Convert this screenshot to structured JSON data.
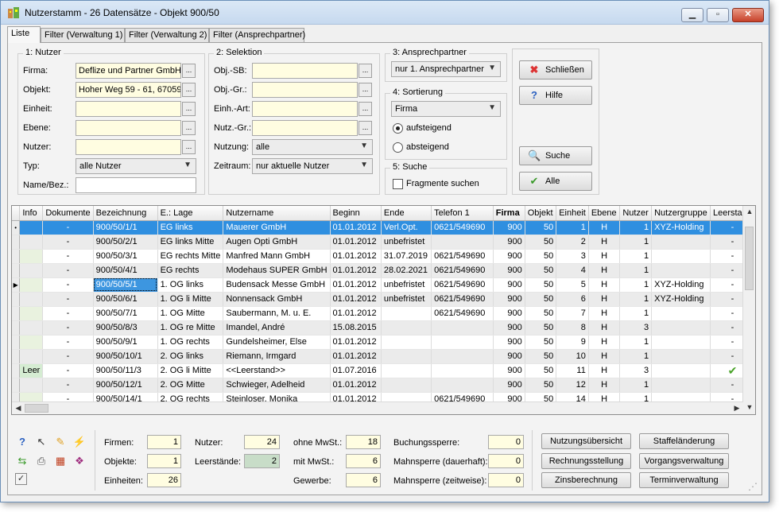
{
  "window": {
    "title": "Nutzerstamm - 26 Datensätze - Objekt 900/50",
    "buttons": {
      "minimize": "▁",
      "maximize": "▫",
      "close": "✕"
    }
  },
  "tabs": [
    "Liste",
    "Filter (Verwaltung 1)",
    "Filter (Verwaltung 2)",
    "Filter (Ansprechpartner)"
  ],
  "group_nutzer": {
    "title": "1: Nutzer",
    "firma_label": "Firma:",
    "firma_value": "Deflize und Partner GmbH",
    "objekt_label": "Objekt:",
    "objekt_value": "Hoher Weg 59 - 61, 67059",
    "einheit_label": "Einheit:",
    "ebene_label": "Ebene:",
    "nutzer_label": "Nutzer:",
    "typ_label": "Typ:",
    "typ_value": "alle Nutzer",
    "namebez_label": "Name/Bez.:",
    "dots": "..."
  },
  "group_selektion": {
    "title": "2: Selektion",
    "objsb_label": "Obj.-SB:",
    "objgr_label": "Obj.-Gr.:",
    "einhart_label": "Einh.-Art:",
    "nutzgr_label": "Nutz.-Gr.:",
    "nutzung_label": "Nutzung:",
    "nutzung_value": "alle",
    "zeitraum_label": "Zeitraum:",
    "zeitraum_value": "nur aktuelle Nutzer"
  },
  "group_ansprech": {
    "title": "3: Ansprechpartner",
    "value": "nur 1. Ansprechpartner"
  },
  "group_sort": {
    "title": "4: Sortierung",
    "value": "Firma",
    "asc": "aufsteigend",
    "desc": "absteigend"
  },
  "group_suche": {
    "title": "5: Suche",
    "fragment": "Fragmente suchen"
  },
  "actions": {
    "close": "Schließen",
    "help": "Hilfe",
    "search": "Suche",
    "all": "Alle"
  },
  "grid": {
    "columns": [
      "Info",
      "Dokumente",
      "Bezeichnung",
      "E.: Lage",
      "Nutzername",
      "Beginn",
      "Ende",
      "Telefon 1",
      "Firma",
      "Objekt",
      "Einheit",
      "Ebene",
      "Nutzer",
      "Nutzergruppe",
      "Leerstand"
    ],
    "rows": [
      {
        "ind": "•",
        "info": "",
        "doc": "-",
        "bez": "900/50/1/1",
        "lage": "EG links",
        "name": "Mauerer GmbH",
        "beginn": "01.01.2012",
        "ende": "Verl.Opt.",
        "tel": "0621/549690",
        "firma": "900",
        "objekt": "50",
        "einheit": "1",
        "ebene": "H",
        "nutzer": "1",
        "gruppe": "XYZ-Holding",
        "leer": "-"
      },
      {
        "ind": "",
        "info": "",
        "doc": "-",
        "bez": "900/50/2/1",
        "lage": "EG links Mitte",
        "name": "Augen Opti GmbH",
        "beginn": "01.01.2012",
        "ende": "unbefristet",
        "tel": "",
        "firma": "900",
        "objekt": "50",
        "einheit": "2",
        "ebene": "H",
        "nutzer": "1",
        "gruppe": "",
        "leer": "-"
      },
      {
        "ind": "",
        "info": "",
        "doc": "-",
        "bez": "900/50/3/1",
        "lage": "EG rechts Mitte",
        "name": "Manfred Mann GmbH",
        "beginn": "01.01.2012",
        "ende": "31.07.2019",
        "tel": "0621/549690",
        "firma": "900",
        "objekt": "50",
        "einheit": "3",
        "ebene": "H",
        "nutzer": "1",
        "gruppe": "",
        "leer": "-"
      },
      {
        "ind": "",
        "info": "",
        "doc": "-",
        "bez": "900/50/4/1",
        "lage": "EG rechts",
        "name": "Modehaus SUPER GmbH",
        "beginn": "01.01.2012",
        "ende": "28.02.2021",
        "tel": "0621/549690",
        "firma": "900",
        "objekt": "50",
        "einheit": "4",
        "ebene": "H",
        "nutzer": "1",
        "gruppe": "",
        "leer": "-"
      },
      {
        "ind": "▶",
        "info": "",
        "doc": "-",
        "bez": "900/50/5/1",
        "lage": "1. OG links",
        "name": "Budensack Messe GmbH",
        "beginn": "01.01.2012",
        "ende": "unbefristet",
        "tel": "0621/549690",
        "firma": "900",
        "objekt": "50",
        "einheit": "5",
        "ebene": "H",
        "nutzer": "1",
        "gruppe": "XYZ-Holding",
        "leer": "-"
      },
      {
        "ind": "",
        "info": "",
        "doc": "-",
        "bez": "900/50/6/1",
        "lage": "1. OG li Mitte",
        "name": "Nonnensack GmbH",
        "beginn": "01.01.2012",
        "ende": "unbefristet",
        "tel": "0621/549690",
        "firma": "900",
        "objekt": "50",
        "einheit": "6",
        "ebene": "H",
        "nutzer": "1",
        "gruppe": "XYZ-Holding",
        "leer": "-"
      },
      {
        "ind": "",
        "info": "",
        "doc": "-",
        "bez": "900/50/7/1",
        "lage": "1. OG Mitte",
        "name": "Saubermann, M. u. E.",
        "beginn": "01.01.2012",
        "ende": "",
        "tel": "0621/549690",
        "firma": "900",
        "objekt": "50",
        "einheit": "7",
        "ebene": "H",
        "nutzer": "1",
        "gruppe": "",
        "leer": "-"
      },
      {
        "ind": "",
        "info": "",
        "doc": "-",
        "bez": "900/50/8/3",
        "lage": "1. OG re Mitte",
        "name": "Imandel, André",
        "beginn": "15.08.2015",
        "ende": "",
        "tel": "",
        "firma": "900",
        "objekt": "50",
        "einheit": "8",
        "ebene": "H",
        "nutzer": "3",
        "gruppe": "",
        "leer": "-"
      },
      {
        "ind": "",
        "info": "",
        "doc": "-",
        "bez": "900/50/9/1",
        "lage": "1. OG rechts",
        "name": "Gundelsheimer, Else",
        "beginn": "01.01.2012",
        "ende": "",
        "tel": "",
        "firma": "900",
        "objekt": "50",
        "einheit": "9",
        "ebene": "H",
        "nutzer": "1",
        "gruppe": "",
        "leer": "-"
      },
      {
        "ind": "",
        "info": "",
        "doc": "-",
        "bez": "900/50/10/1",
        "lage": "2. OG links",
        "name": "Riemann, Irmgard",
        "beginn": "01.01.2012",
        "ende": "",
        "tel": "",
        "firma": "900",
        "objekt": "50",
        "einheit": "10",
        "ebene": "H",
        "nutzer": "1",
        "gruppe": "",
        "leer": "-"
      },
      {
        "ind": "",
        "info": "Leer",
        "doc": "-",
        "bez": "900/50/11/3",
        "lage": "2. OG li Mitte",
        "name": "<<Leerstand>>",
        "beginn": "01.07.2016",
        "ende": "",
        "tel": "",
        "firma": "900",
        "objekt": "50",
        "einheit": "11",
        "ebene": "H",
        "nutzer": "3",
        "gruppe": "",
        "leer": "✔"
      },
      {
        "ind": "",
        "info": "",
        "doc": "-",
        "bez": "900/50/12/1",
        "lage": "2. OG Mitte",
        "name": "Schwieger, Adelheid",
        "beginn": "01.01.2012",
        "ende": "",
        "tel": "",
        "firma": "900",
        "objekt": "50",
        "einheit": "12",
        "ebene": "H",
        "nutzer": "1",
        "gruppe": "",
        "leer": "-"
      },
      {
        "ind": "",
        "info": "",
        "doc": "-",
        "bez": "900/50/14/1",
        "lage": "2. OG rechts",
        "name": "Steinloser, Monika",
        "beginn": "01.01.2012",
        "ende": "",
        "tel": "0621/549690",
        "firma": "900",
        "objekt": "50",
        "einheit": "14",
        "ebene": "H",
        "nutzer": "1",
        "gruppe": "",
        "leer": "-"
      }
    ]
  },
  "summary": {
    "firmen_label": "Firmen:",
    "firmen": "1",
    "objekte_label": "Objekte:",
    "objekte": "1",
    "einheiten_label": "Einheiten:",
    "einheiten": "26",
    "nutzer_label": "Nutzer:",
    "nutzer": "24",
    "leer_label": "Leerstände:",
    "leer": "2",
    "ohne_label": "ohne MwSt.:",
    "ohne": "18",
    "mit_label": "mit MwSt.:",
    "mit": "6",
    "gewerbe_label": "Gewerbe:",
    "gewerbe": "6",
    "buch_label": "Buchungssperre:",
    "buch": "0",
    "mahn_d_label": "Mahnsperre (dauerhaft):",
    "mahn_d": "0",
    "mahn_z_label": "Mahnsperre (zeitweise):",
    "mahn_z": "0"
  },
  "bottom_buttons": {
    "nutzungsuebersicht": "Nutzungsübersicht",
    "staffel": "Staffeländerung",
    "rechnung": "Rechnungsstellung",
    "vorgang": "Vorgangsverwaltung",
    "zins": "Zinsberechnung",
    "termin": "Terminverwaltung"
  },
  "colors": {
    "selection": "#2f8fe0",
    "input_bg": "#fffde1",
    "green_field": "#c8ddc8"
  }
}
